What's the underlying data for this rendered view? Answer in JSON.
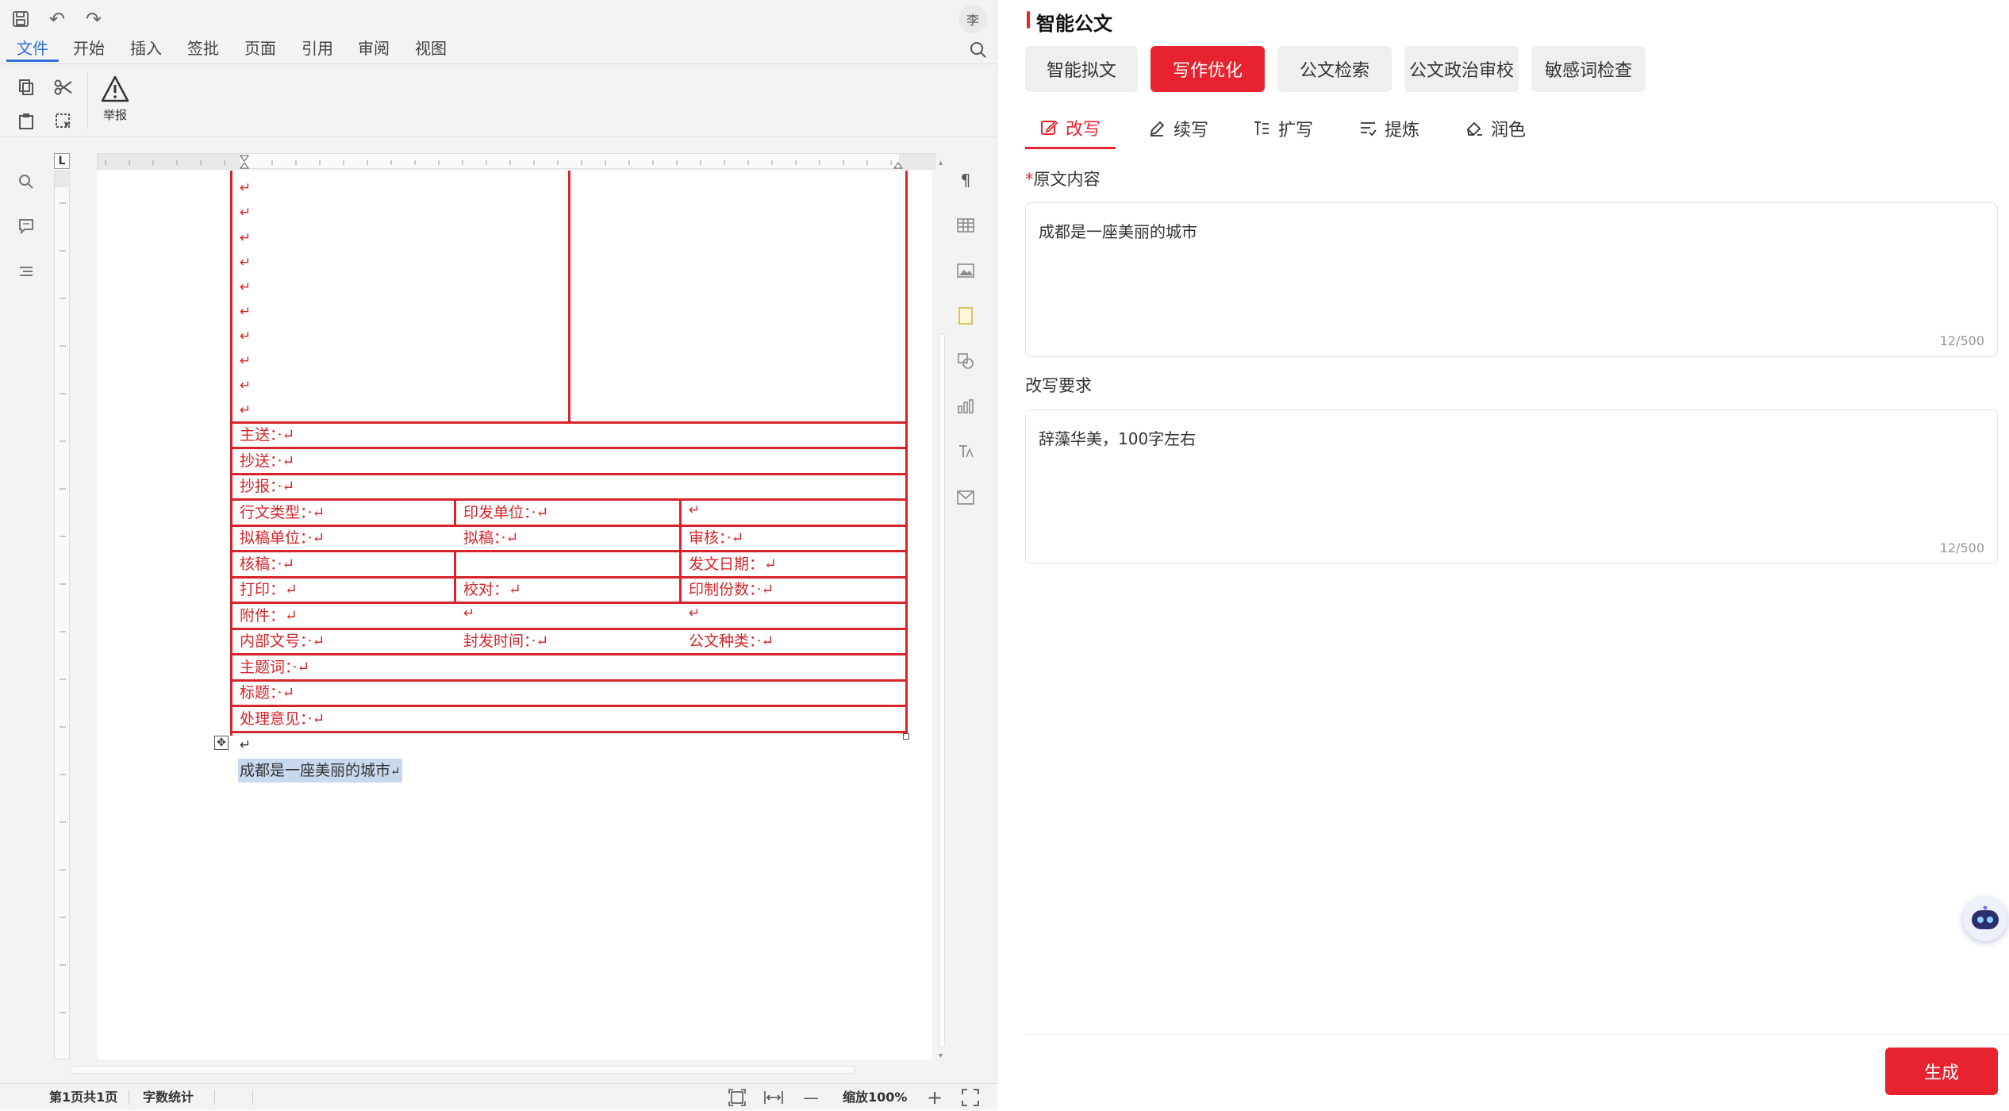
{
  "toolbar": {
    "menu_tabs": [
      "文件",
      "开始",
      "插入",
      "签批",
      "页面",
      "引用",
      "审阅",
      "视图"
    ],
    "report_label": "举报",
    "user_initial": "李"
  },
  "document": {
    "marker": "↵",
    "rows": {
      "main_to": "主送：·↵",
      "cc": "抄送：·↵",
      "report_to": "抄报：·↵",
      "doc_type": "行文类型：·↵",
      "issuing_unit": "印发单位：·↵",
      "drafting_unit": "拟稿单位：·↵",
      "drafter": "拟稿：·↵",
      "reviewer": "审核：·↵",
      "checker": "核稿：·↵",
      "issue_date": "发文日期：↵",
      "print": "打印：↵",
      "proofread": "校对：↵",
      "copies": "印制份数：·↵",
      "attachment": "附件：↵",
      "internal_no": "内部文号：·↵",
      "seal_time": "封发时间：·↵",
      "doc_kind": "公文种类：·↵",
      "subject_words": "主题词：·↵",
      "title": "标题：·↵",
      "opinion": "处理意见：·↵"
    },
    "body_text": "成都是一座美丽的城市",
    "body_end": "↵"
  },
  "status": {
    "page_info": "第1页共1页",
    "word_count": "字数统计",
    "zoom": "缩放100%"
  },
  "panel": {
    "title": "智能公文",
    "tabs": [
      "智能拟文",
      "写作优化",
      "公文检索",
      "公文政治审校",
      "敏感词检查"
    ],
    "active_tab": "写作优化",
    "subtabs": [
      "改写",
      "续写",
      "扩写",
      "提炼",
      "润色"
    ],
    "active_subtab": "改写",
    "original": {
      "required_mark": "*",
      "label": "原文内容",
      "value": "成都是一座美丽的城市",
      "counter": "12/500"
    },
    "requirement": {
      "label": "改写要求",
      "value": "辞藻华美，100字左右",
      "counter": "12/500"
    },
    "generate_label": "生成"
  },
  "colors": {
    "accent_red": "#e8232f",
    "doc_red": "#d6242a",
    "editor_blue": "#2f6fd6",
    "selection": "#c9d8ee"
  }
}
